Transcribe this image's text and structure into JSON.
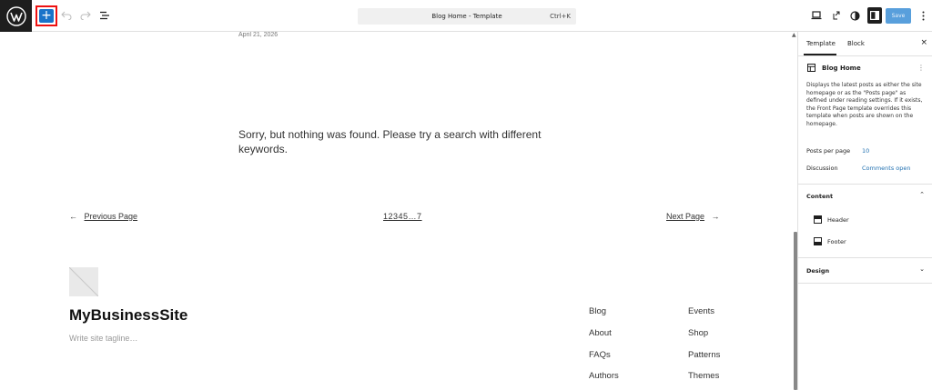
{
  "toolbar": {
    "add_label": "+",
    "command_title": "Blog Home - Template",
    "command_shortcut": "Ctrl+K",
    "save_label": "Save"
  },
  "canvas": {
    "post_date": "April 21, 2026",
    "no_results": "Sorry, but nothing was found. Please try a search with different keywords.",
    "pagination": {
      "prev_arrow": "←",
      "prev_label": "Previous Page",
      "pages": "12345…7",
      "next_label": "Next Page",
      "next_arrow": "→"
    },
    "site_title": "MyBusinessSite",
    "site_tagline": "Write site tagline…",
    "footer_links_col1": [
      "Blog",
      "About",
      "FAQs",
      "Authors"
    ],
    "footer_links_col2": [
      "Events",
      "Shop",
      "Patterns",
      "Themes"
    ]
  },
  "panel": {
    "tabs": [
      "Template",
      "Block"
    ],
    "close": "×",
    "template_title": "Blog Home",
    "template_menu": "⋮",
    "description": "Displays the latest posts as either the site homepage or as the \"Posts page\" as defined under reading settings. If it exists, the Front Page template overrides this template when posts are shown on the homepage.",
    "posts_per_page_label": "Posts per page",
    "posts_per_page_value": "10",
    "discussion_label": "Discussion",
    "discussion_value": "Comments open",
    "content_section": "Content",
    "content_chevron": "⌃",
    "areas": [
      "Header",
      "Footer"
    ],
    "design_section": "Design",
    "design_chevron": "⌄"
  },
  "colors": {
    "accent": "#1a73c9",
    "highlight_border": "#ee1111",
    "link": "#2271b1"
  }
}
